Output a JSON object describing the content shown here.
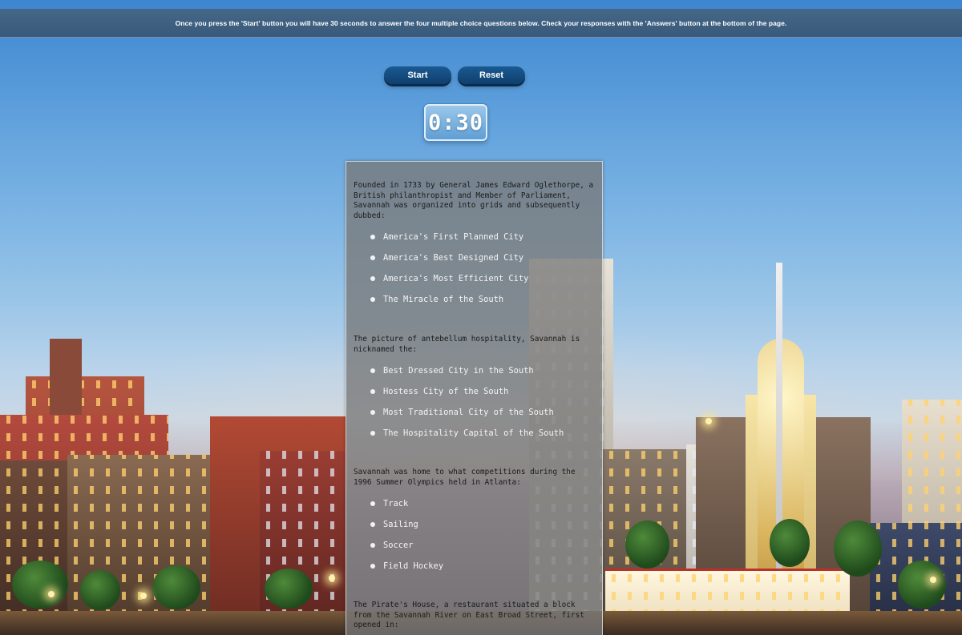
{
  "banner": {
    "instructions": "Once you press the 'Start' button you will have 30 seconds to answer the four multiple choice questions below. Check your responses with the 'Answers' button at the bottom of the page."
  },
  "controls": {
    "start_label": "Start",
    "reset_label": "Reset"
  },
  "timer": {
    "display": "0:30"
  },
  "quiz": {
    "questions": [
      {
        "text": "Founded in 1733 by General James Edward Oglethorpe, a British philanthropist and Member of Parliament, Savannah was organized into grids and subsequently dubbed:",
        "options": [
          "America's First Planned City",
          "America's Best Designed City",
          "America's Most Efficient City",
          "The Miracle of the South"
        ]
      },
      {
        "text": "The picture of antebellum hospitality, Savannah is nicknamed the:",
        "options": [
          "Best Dressed City in the South",
          "Hostess City of the South",
          "Most Traditional City of the South",
          "The Hospitality Capital of the South"
        ]
      },
      {
        "text": "Savannah was home to what competitions during the 1996 Summer Olympics held in Atlanta:",
        "options": [
          "Track",
          "Sailing",
          "Soccer",
          "Field Hockey"
        ]
      },
      {
        "text": "The Pirate's House, a restaurant situated a block from the Savannah River on East Broad Street, first opened in:",
        "options": []
      }
    ]
  }
}
